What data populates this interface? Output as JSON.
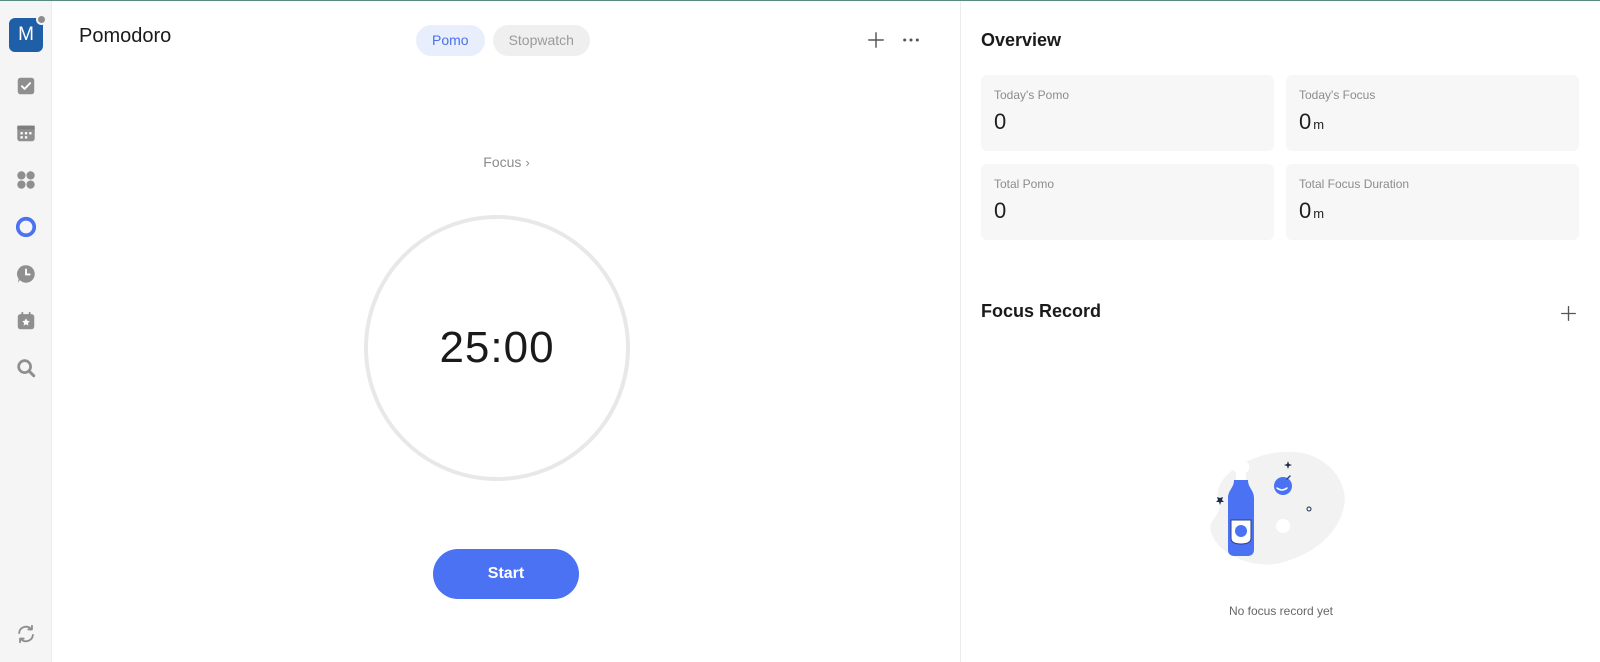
{
  "sidebar": {
    "avatar_letter": "M",
    "items": [
      {
        "icon": "task-check-icon"
      },
      {
        "icon": "calendar-icon"
      },
      {
        "icon": "matrix-icon"
      },
      {
        "icon": "pomodoro-icon",
        "active": true
      },
      {
        "icon": "habit-clock-icon"
      },
      {
        "icon": "countdown-icon"
      },
      {
        "icon": "search-icon"
      }
    ],
    "sync_icon": "sync-icon"
  },
  "header": {
    "title": "Pomodoro",
    "tabs": [
      {
        "label": "Pomo",
        "active": true
      },
      {
        "label": "Stopwatch",
        "active": false
      }
    ],
    "add_icon": "plus-icon",
    "more_icon": "more-icon"
  },
  "timer": {
    "focus_label": "Focus",
    "time": "25:00",
    "start_label": "Start"
  },
  "overview": {
    "title": "Overview",
    "stats": [
      {
        "label": "Today's Pomo",
        "value": "0",
        "unit": ""
      },
      {
        "label": "Today's Focus",
        "value": "0",
        "unit": "m"
      },
      {
        "label": "Total Pomo",
        "value": "0",
        "unit": ""
      },
      {
        "label": "Total Focus Duration",
        "value": "0",
        "unit": "m"
      }
    ]
  },
  "focus_record": {
    "title": "Focus Record",
    "empty_text": "No focus record yet"
  },
  "colors": {
    "accent": "#4a72f2",
    "active_tab_bg": "#e8eefc",
    "avatar": "#1f5fa8"
  }
}
